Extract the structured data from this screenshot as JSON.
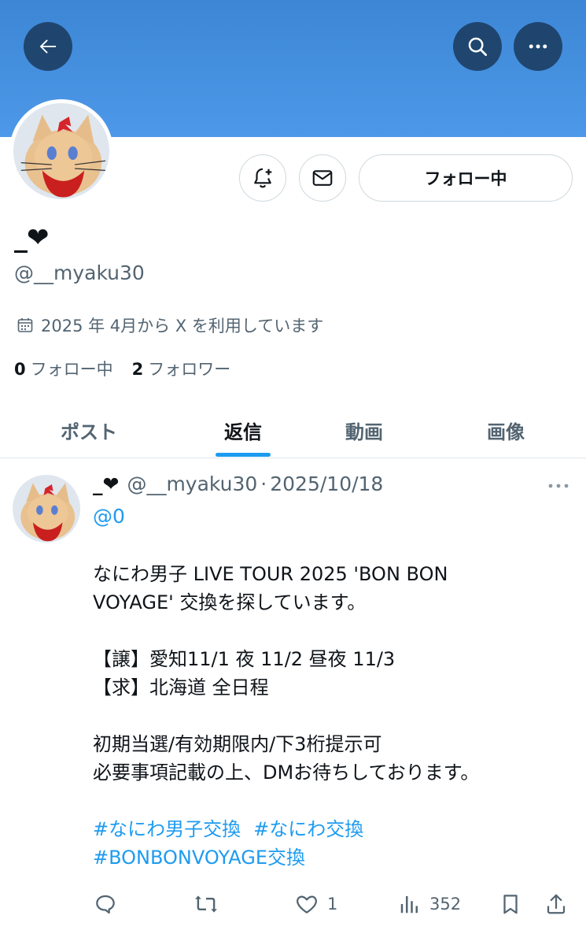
{
  "header": {
    "back_icon": "arrow-left-icon",
    "search_icon": "search-icon",
    "more_icon": "more-horizontal-icon",
    "banner_color": "#4a94e4"
  },
  "profile": {
    "display_name": "_❤",
    "handle": "@__myaku30",
    "joined": "2025 年 4月から X を利用しています",
    "following_count": "0",
    "following_label": "フォロー中",
    "followers_count": "2",
    "followers_label": "フォロワー",
    "follow_button_label": "フォロー中",
    "notify_icon": "bell-plus-icon",
    "message_icon": "mail-icon"
  },
  "tabs": [
    {
      "label": "ポスト",
      "active": false
    },
    {
      "label": "返信",
      "active": true
    },
    {
      "label": "動画",
      "active": false
    },
    {
      "label": "画像",
      "active": false
    }
  ],
  "post": {
    "name": "_❤",
    "handle": "@__myaku30",
    "separator": "·",
    "date": "2025/10/18",
    "reply_to": "@0",
    "lines1": "なにわ男子 LIVE TOUR 2025 'BON BON\nVOYAGE' 交換を探しています。",
    "lines2": "【譲】愛知11/1 夜 11/2 昼夜 11/3\n【求】北海道 全日程",
    "lines3": "初期当選/有効期限内/下3桁提示可\n必要事項記載の上、DMお待ちしております。",
    "hashtags": [
      "#なにわ男子交換",
      "#なにわ交換",
      "#BONBONVOYAGE交換"
    ],
    "actions": {
      "reply_count": "",
      "repost_count": "",
      "like_count": "1",
      "views_count": "352"
    }
  },
  "colors": {
    "accent": "#1d9bf0",
    "muted": "#536471",
    "text": "#0f1419"
  }
}
